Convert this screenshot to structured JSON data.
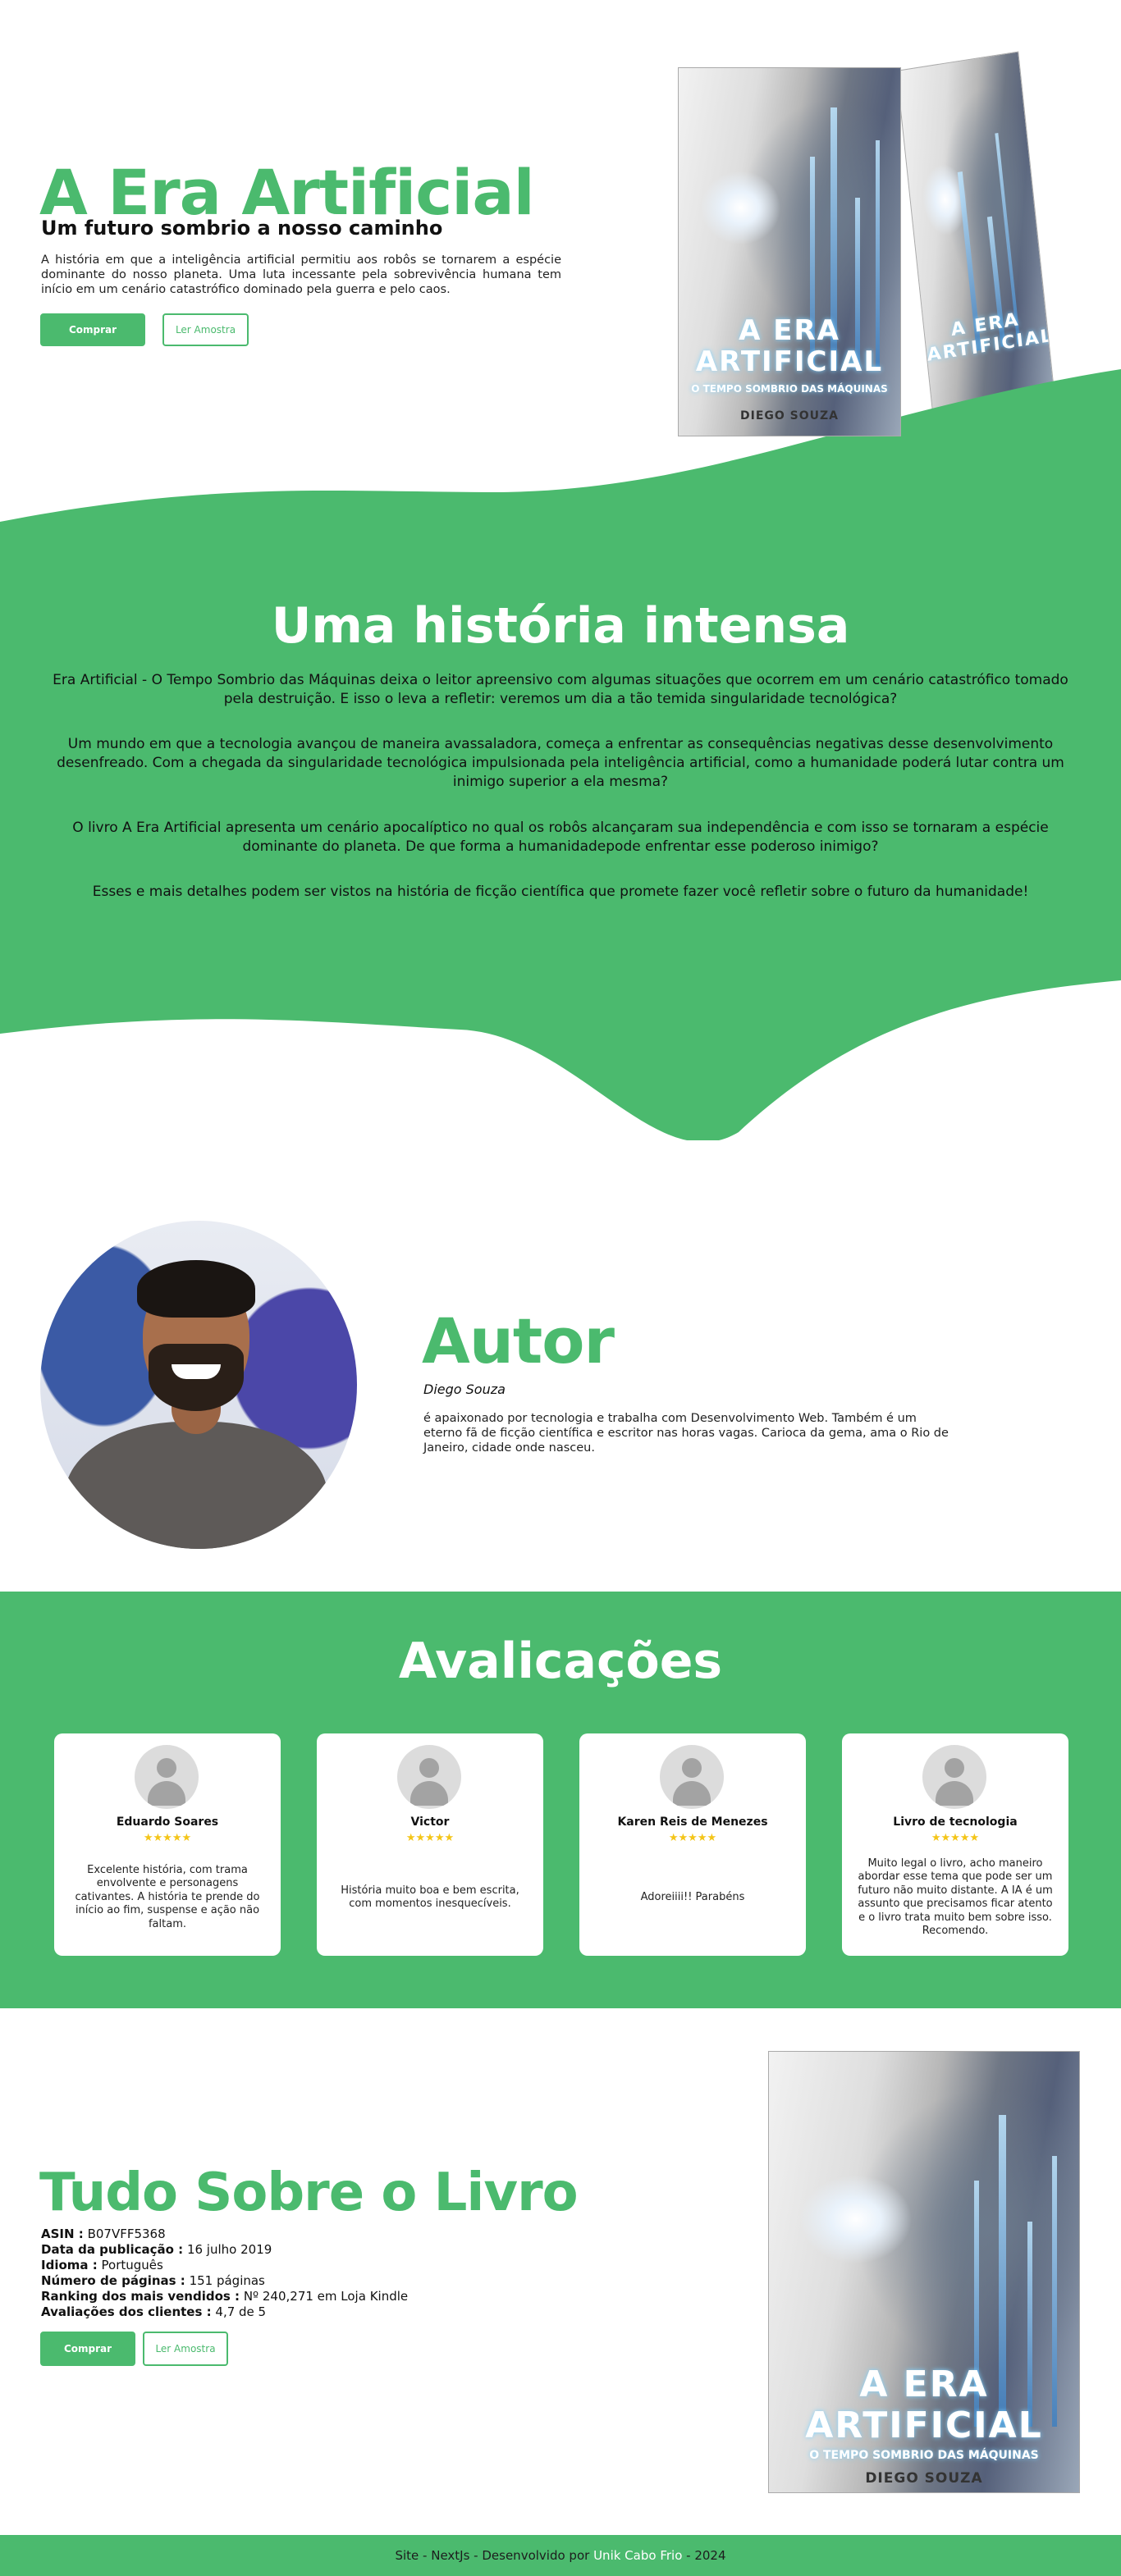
{
  "hero": {
    "title": "A Era Artificial",
    "subtitle": "Um futuro sombrio a nosso caminho",
    "description": "A história em que a inteligência artificial permitiu aos robôs se tornarem a espécie dominante do nosso planeta. Uma luta incessante pela sobrevivência humana tem início em um cenário catastrófico dominado pela guerra e pelo caos.",
    "buy_label": "Comprar",
    "sample_label": "Ler Amostra"
  },
  "book_cover": {
    "title_line1": "A ERA",
    "title_line2": "ARTIFICIAL",
    "subtitle": "O TEMPO SOMBRIO DAS MÁQUINAS",
    "author": "DIEGO SOUZA"
  },
  "story": {
    "title": "Uma história intensa",
    "paragraphs": [
      "Era Artificial - O Tempo Sombrio das Máquinas deixa o leitor apreensivo com algumas situações que ocorrem em um cenário catastrófico tomado pela destruição. E isso o leva a refletir: veremos um dia a tão temida singularidade tecnológica?",
      "Um mundo em que a tecnologia avançou de maneira avassaladora, começa a enfrentar as consequências negativas desse desenvolvimento desenfreado. Com a chegada da singularidade tecnológica impulsionada pela inteligência artificial, como a humanidade poderá lutar contra um inimigo superior a ela mesma?",
      "O livro A Era Artificial apresenta um cenário apocalíptico no qual os robôs alcançaram sua independência e com isso se tornaram a espécie dominante do planeta. De que forma a humanidadepode enfrentar esse poderoso inimigo?",
      "Esses e mais detalhes podem ser vistos na história de ficção científica que promete fazer você refletir sobre o futuro da humanidade!"
    ]
  },
  "author": {
    "title": "Autor",
    "name": "Diego Souza",
    "bio": "é apaixonado por tecnologia e trabalha com Desenvolvimento Web. Também é um eterno fã de ficção científica e escritor nas horas vagas. Carioca da gema, ama o Rio de Janeiro, cidade onde nasceu."
  },
  "reviews": {
    "title": "Avalicações",
    "items": [
      {
        "name": "Eduardo Soares",
        "stars": "★★★★★",
        "text": "Excelente história, com trama envolvente e personagens cativantes. A história te prende do início ao fim, suspense e ação não faltam."
      },
      {
        "name": "Victor",
        "stars": "★★★★★",
        "text": "História muito boa e bem escrita, com momentos inesquecíveis."
      },
      {
        "name": "Karen Reis de Menezes",
        "stars": "★★★★★",
        "text": "Adoreiiii!! Parabéns"
      },
      {
        "name": "Livro de tecnologia",
        "stars": "★★★★★",
        "text": "Muito legal o livro, acho maneiro abordar esse tema que pode ser um futuro não muito distante. A IA é um assunto que precisamos ficar atento e o livro trata muito bem sobre isso. Recomendo."
      }
    ]
  },
  "book_info": {
    "title": "Tudo Sobre o Livro",
    "rows": [
      {
        "label": "ASIN :",
        "value": "B07VFF5368"
      },
      {
        "label": "Data da publicação :",
        "value": "16 julho 2019"
      },
      {
        "label": "Idioma :",
        "value": "Português"
      },
      {
        "label": "Número de páginas :",
        "value": "151 páginas"
      },
      {
        "label": "Ranking dos mais vendidos :",
        "value": "Nº 240,271 em Loja Kindle"
      },
      {
        "label": "Avaliações dos clientes :",
        "value": "4,7 de 5"
      }
    ],
    "buy_label": "Comprar",
    "sample_label": "Ler Amostra"
  },
  "footer": {
    "prefix": "Site - NextJs - Desenvolvido por",
    "credit": "Unik Cabo Frio",
    "suffix": "- 2024"
  },
  "colors": {
    "accent": "#4bba6e",
    "stars": "#f4c518",
    "text": "#111111"
  }
}
